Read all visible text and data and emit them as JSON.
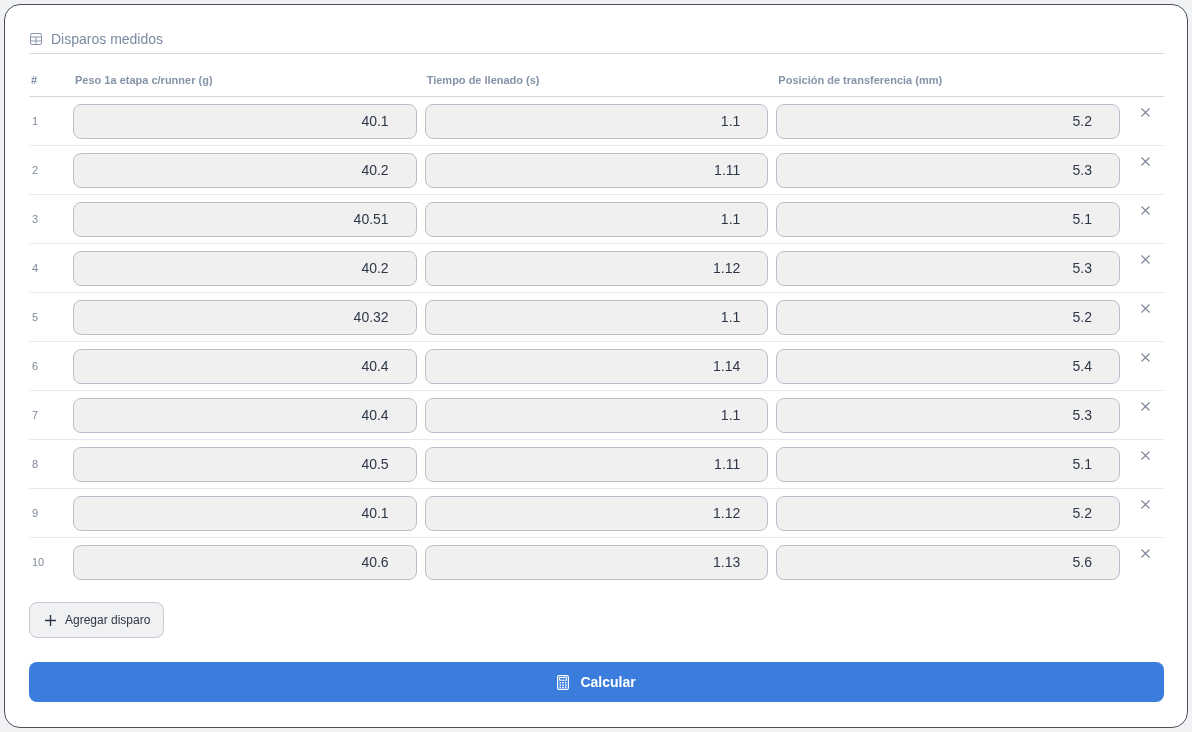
{
  "section": {
    "title": "Disparos medidos"
  },
  "table": {
    "columns": [
      "#",
      "Peso 1a etapa c/runner (g)",
      "Tiempo de llenado (s)",
      "Posición de transferencia (mm)"
    ],
    "rows": [
      {
        "index": "1",
        "values": [
          "40.1",
          "1.1",
          "5.2"
        ]
      },
      {
        "index": "2",
        "values": [
          "40.2",
          "1.11",
          "5.3"
        ]
      },
      {
        "index": "3",
        "values": [
          "40.51",
          "1.1",
          "5.1"
        ]
      },
      {
        "index": "4",
        "values": [
          "40.2",
          "1.12",
          "5.3"
        ]
      },
      {
        "index": "5",
        "values": [
          "40.32",
          "1.1",
          "5.2"
        ]
      },
      {
        "index": "6",
        "values": [
          "40.4",
          "1.14",
          "5.4"
        ]
      },
      {
        "index": "7",
        "values": [
          "40.4",
          "1.1",
          "5.3"
        ]
      },
      {
        "index": "8",
        "values": [
          "40.5",
          "1.11",
          "5.1"
        ]
      },
      {
        "index": "9",
        "values": [
          "40.1",
          "1.12",
          "5.2"
        ]
      },
      {
        "index": "10",
        "values": [
          "40.6",
          "1.13",
          "5.6"
        ]
      }
    ]
  },
  "add_button": {
    "label": "Agregar disparo"
  },
  "calculate_button": {
    "label": "Calcular"
  }
}
